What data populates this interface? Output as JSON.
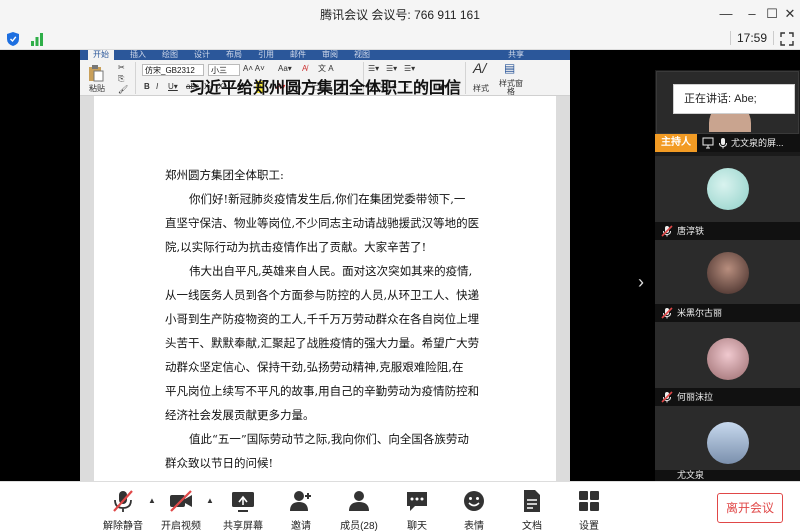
{
  "window": {
    "title": "腾讯会议 会议号: 766 911 161",
    "clock": "17:59"
  },
  "document": {
    "ribbon_tabs": [
      "开始",
      "插入",
      "绘图",
      "设计",
      "布局",
      "引用",
      "邮件",
      "审阅",
      "视图"
    ],
    "ribbon_right": "共享",
    "font_name": "仿宋_GB2312",
    "font_size": "小三",
    "paste_label": "粘贴",
    "styles_label": "样式",
    "style_pane_label": "样式窗格",
    "title": "习近平给郑州圆方集团全体职工的回信",
    "salutation": "郑州圆方集团全体职工:",
    "lines": [
      "你们好!新冠肺炎疫情发生后,你们在集团党委带领下,一",
      "直坚守保洁、物业等岗位,不少同志主动请战驰援武汉等地的医",
      "院,以实际行动为抗击疫情作出了贡献。大家辛苦了!",
      "伟大出自平凡,英雄来自人民。面对这次突如其来的疫情,",
      "从一线医务人员到各个方面参与防控的人员,从环卫工人、快递",
      "小哥到生产防疫物资的工人,千千万万劳动群众在各自岗位上埋",
      "头苦干、默默奉献,汇聚起了战胜疫情的强大力量。希望广大劳",
      "动群众坚定信心、保持干劲,弘扬劳动精神,克服艰难险阻,在",
      "平凡岗位上续写不平凡的故事,用自己的辛勤劳动为疫情防控和",
      "经济社会发展贡献更多力量。",
      "值此“五一”国际劳动节之际,我向你们、向全国各族劳动",
      "群众致以节日的问候!"
    ]
  },
  "participants": {
    "speaking_text": "正在讲话: Abe;",
    "host_badge": "主持人",
    "host_sharing": "尤文泉的屏...",
    "list": [
      {
        "name": "唐淳铁",
        "avatar": "mint-avatar",
        "color": "#a9e0da"
      },
      {
        "name": "米黑尔古丽",
        "avatar": "person-avatar",
        "color": "#6b4b44"
      },
      {
        "name": "何丽沫拉",
        "avatar": "person-avatar",
        "color": "#d9a7b1"
      },
      {
        "name": "尤文泉",
        "avatar": "tower-avatar",
        "color": "#9fb8d6"
      }
    ]
  },
  "toolbar": {
    "unmute": "解除静音",
    "start_video": "开启视频",
    "share_screen": "共享屏幕",
    "invite": "邀请",
    "members": "成员(28)",
    "chat": "聊天",
    "reactions": "表情",
    "docs": "文档",
    "settings": "设置",
    "leave": "离开会议"
  },
  "colors": {
    "word_blue": "#2b579a",
    "host_orange": "#f29b24",
    "leave_red": "#e04848",
    "muted_red": "#e04848"
  }
}
